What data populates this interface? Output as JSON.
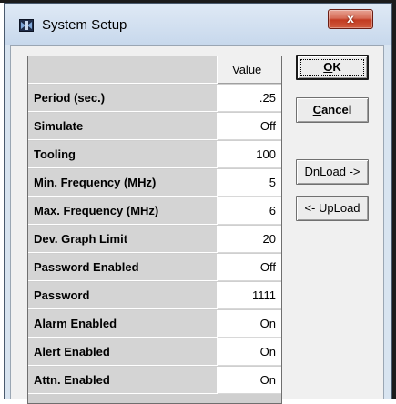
{
  "window": {
    "title": "System Setup",
    "close_glyph": "x"
  },
  "table": {
    "header_value": "Value",
    "rows": [
      {
        "label": "Period (sec.)",
        "value": ".25"
      },
      {
        "label": "Simulate",
        "value": "Off"
      },
      {
        "label": "Tooling",
        "value": "100"
      },
      {
        "label": "Min. Frequency (MHz)",
        "value": "5"
      },
      {
        "label": "Max. Frequency (MHz)",
        "value": "6"
      },
      {
        "label": "Dev. Graph Limit",
        "value": "20"
      },
      {
        "label": "Password Enabled",
        "value": "Off"
      },
      {
        "label": "Password",
        "value": "1111"
      },
      {
        "label": "Alarm Enabled",
        "value": "On"
      },
      {
        "label": "Alert Enabled",
        "value": "On"
      },
      {
        "label": "Attn. Enabled",
        "value": "On"
      }
    ]
  },
  "buttons": {
    "ok": {
      "prefix": "",
      "accel": "O",
      "rest": "K"
    },
    "cancel": {
      "prefix": "",
      "accel": "C",
      "rest": "ancel"
    },
    "download": "DnLoad ->",
    "upload": "<- UpLoad"
  },
  "colors": {
    "close_button": "#c23a20",
    "titlebar": "#d8e4f0",
    "client": "#f0f0f0"
  }
}
